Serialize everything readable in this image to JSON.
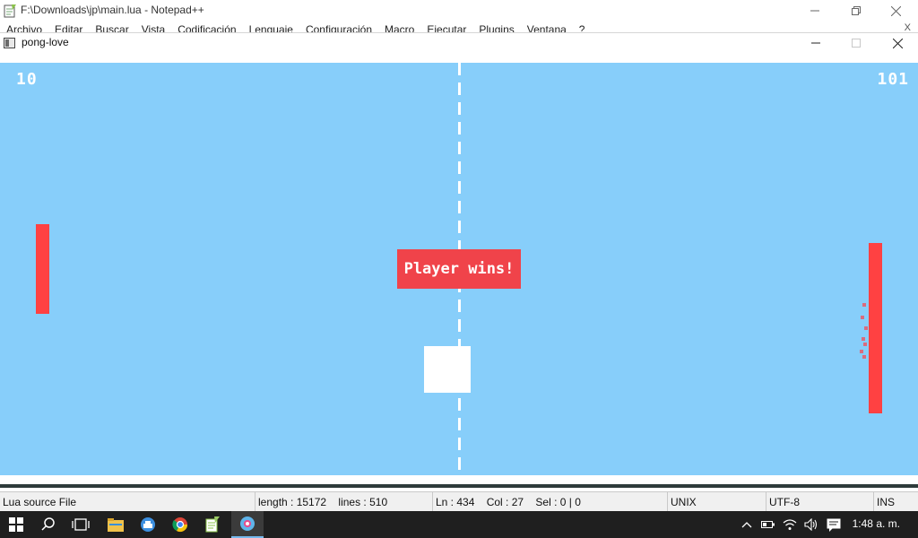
{
  "notepad": {
    "title": "F:\\Downloads\\jp\\main.lua - Notepad++",
    "menu": [
      "Archivo",
      "Editar",
      "Buscar",
      "Vista",
      "Codificación",
      "Lenguaje",
      "Configuración",
      "Macro",
      "Ejecutar",
      "Plugins",
      "Ventana",
      "?"
    ],
    "menu_close": "X"
  },
  "love_window": {
    "title": "pong-love"
  },
  "game": {
    "score_left": "10",
    "score_right": "101",
    "banner": "Player wins!",
    "colors": {
      "background": "#87cefa",
      "paddle": "#ff4142",
      "banner": "#f0434a",
      "ball": "#ffffff"
    }
  },
  "status": {
    "file_type": "Lua source File",
    "length": "length : 15172",
    "lines": "lines : 510",
    "ln": "Ln : 434",
    "col": "Col : 27",
    "sel": "Sel : 0 | 0",
    "eol": "UNIX",
    "encoding": "UTF-8",
    "mode": "INS"
  },
  "taskbar": {
    "icons": [
      "windows-start-icon",
      "search-icon",
      "task-view-icon",
      "file-explorer-icon",
      "browser-icon",
      "chrome-icon",
      "notepadpp-icon",
      "love-icon"
    ],
    "time": "1:48 a. m."
  }
}
